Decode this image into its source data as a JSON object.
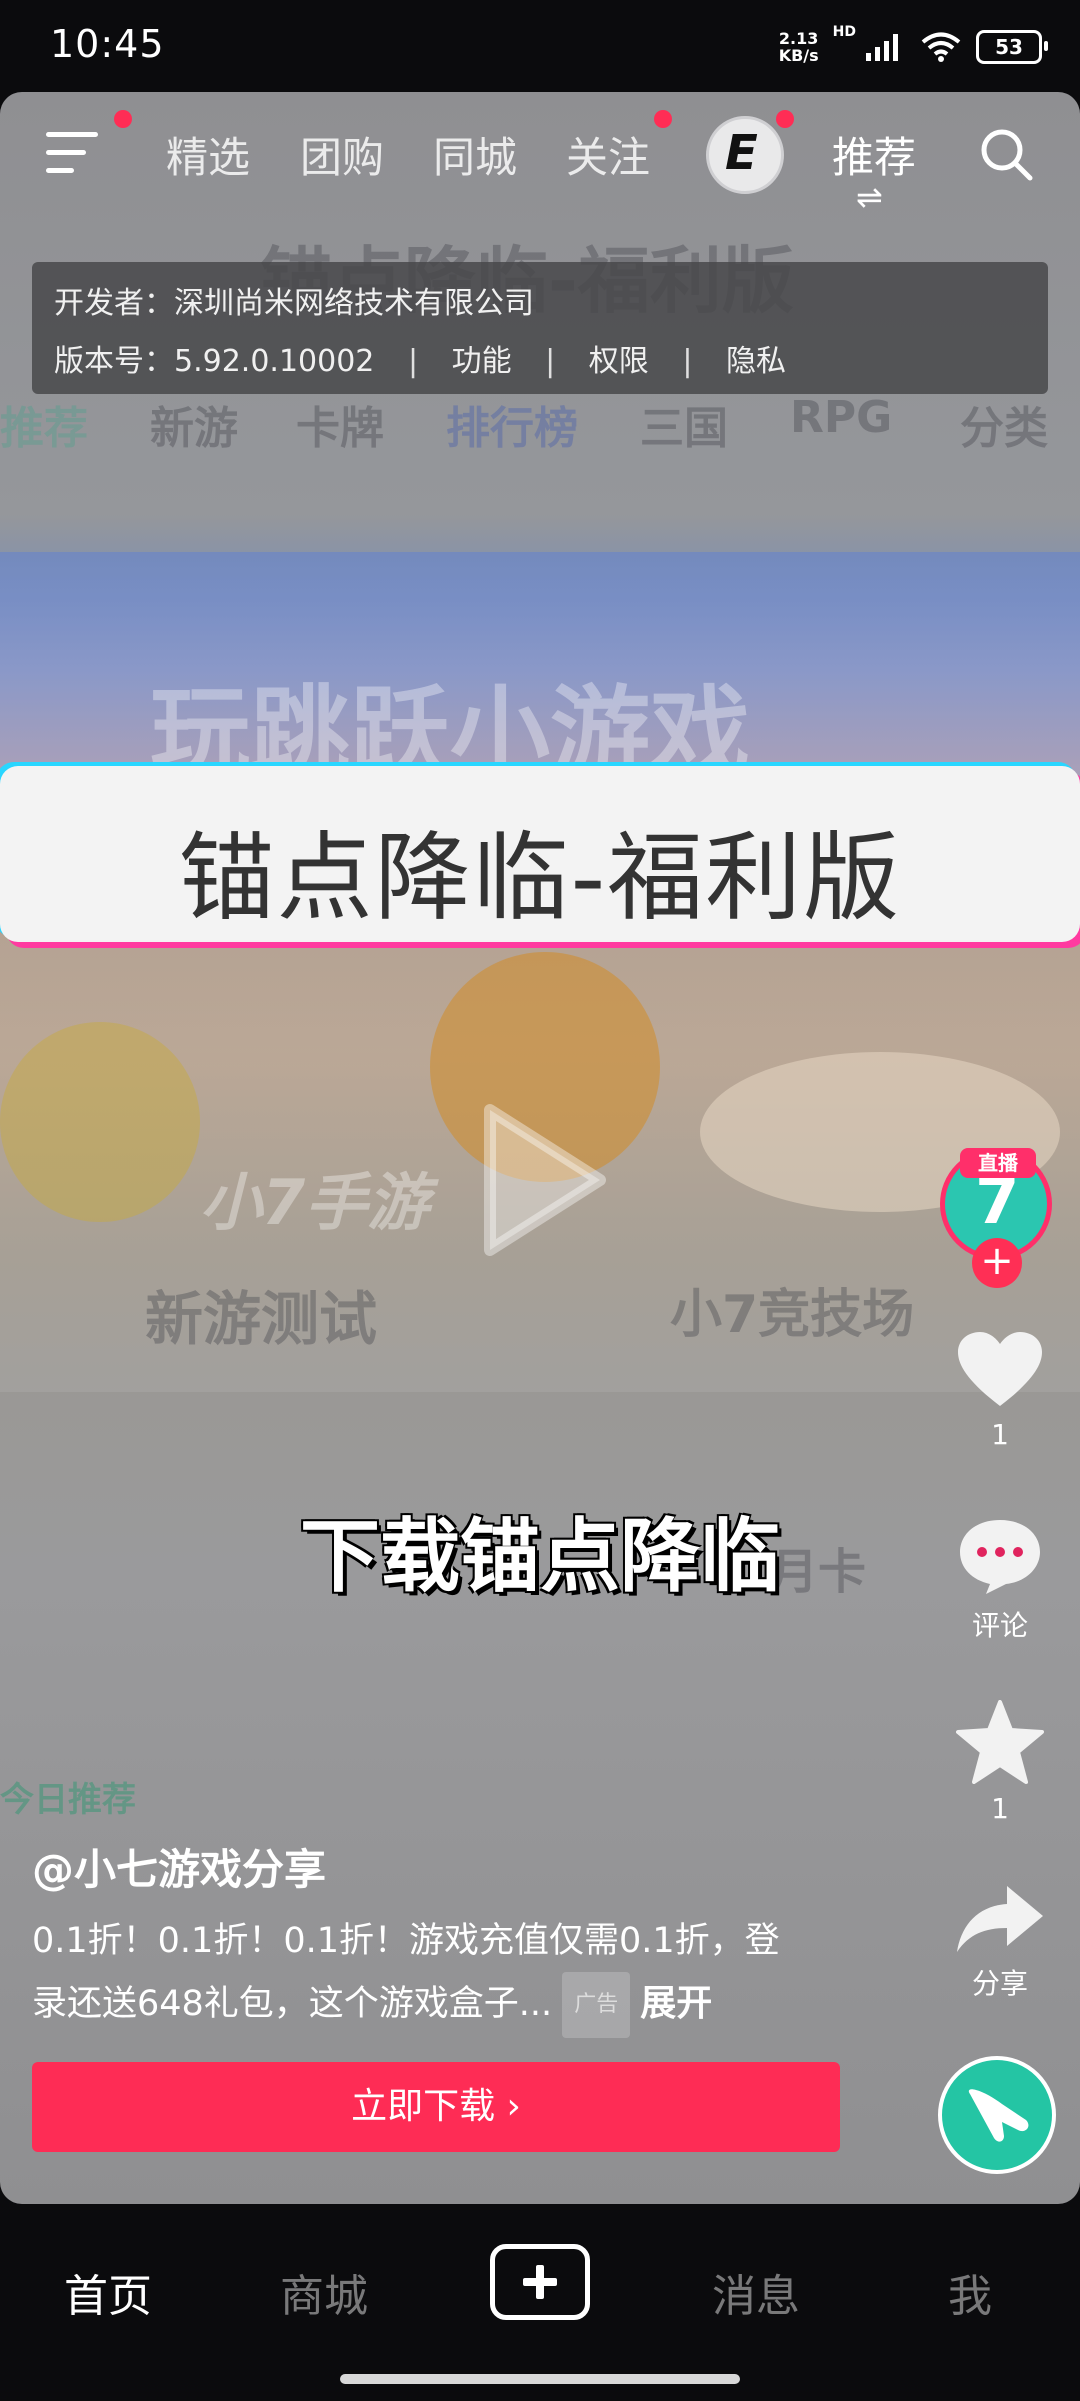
{
  "status_bar": {
    "time": "10:45",
    "net_speed_value": "2.13",
    "net_speed_unit": "KB/s",
    "hd_label": "HD",
    "battery": "53",
    "icons": [
      "signal-icon",
      "wifi-icon",
      "battery-icon"
    ]
  },
  "top_nav": {
    "tabs": [
      "精选",
      "团购",
      "同城",
      "关注",
      "推荐"
    ],
    "active_tab": "推荐",
    "logo_letter": "E",
    "swap_glyph": "⇌"
  },
  "dev_info": {
    "developer_label": "开发者：",
    "developer": "深圳尚米网络技术有限公司",
    "version_label": "版本号：",
    "version": "5.92.0.10002",
    "links": [
      "功能",
      "权限",
      "隐私"
    ]
  },
  "video": {
    "title_banner": "锚点降临-福利版",
    "caption": "下载锚点降临",
    "ghost": {
      "title": "锚点降临-福利版",
      "tabs": [
        "推荐",
        "新游",
        "卡牌",
        "排行榜",
        "三国",
        "RPG",
        "分类"
      ],
      "banner": "玩跳跃小游戏",
      "brand": "小7手游",
      "new_badge": "新游测试",
      "arena": "小7竞技场",
      "card": "月卡",
      "bottom_badge": "今日推荐"
    }
  },
  "side": {
    "live_badge": "直播",
    "avatar_char": "7",
    "like_count": "1",
    "comment_label": "评论",
    "favorite_count": "1",
    "share_label": "分享"
  },
  "post": {
    "author": "@小七游戏分享",
    "desc_line1": "0.1折！0.1折！0.1折！游戏充值仅需0.1折，登",
    "desc_line2": "录还送648礼包，这个游戏盒子...",
    "ad_tag": "广告",
    "expand": "展开",
    "download": "立即下载 ›"
  },
  "bottom_nav": {
    "items": [
      "首页",
      "商城",
      "消息",
      "我"
    ],
    "active": "首页"
  },
  "colors": {
    "accent": "#fe2c55",
    "teal": "#2bc6b0"
  }
}
